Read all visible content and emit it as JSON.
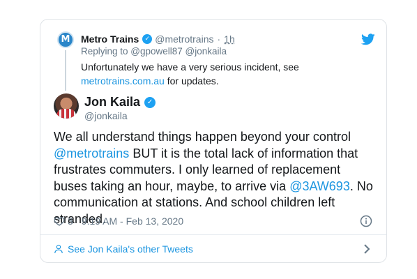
{
  "parent_tweet": {
    "avatar_text": "M",
    "name": "Metro Trains",
    "handle": "@metrotrains",
    "separator": "·",
    "time": "1h",
    "replying_prefix": "Replying to ",
    "replying_to": "@gpowell87 @jonkaila",
    "text_before_link": "Unfortunately we have a very serious incident, see ",
    "link": "metrotrains.com.au",
    "text_after_link": " for updates."
  },
  "main_tweet": {
    "name": "Jon Kaila",
    "handle": "@jonkaila",
    "text_part1": "We all understand things happen beyond your control ",
    "mention1": "@metrotrains",
    "text_part2": " BUT it is the total lack of information that frustrates commuters. I only learned of replacement buses taking an hour, maybe, to arrive via ",
    "mention2": "@3AW693",
    "text_part3": ". No communication at stations. And school children left stranded.",
    "likes": "3",
    "timestamp": "9:19 AM - Feb 13, 2020"
  },
  "footer": {
    "see_more_label": "See Jon Kaila's other Tweets"
  },
  "icons": {
    "verified": "verified-badge-icon",
    "twitter": "twitter-bird-icon",
    "heart": "heart-icon",
    "info": "info-icon",
    "user": "user-icon",
    "chevron": "chevron-right-icon"
  },
  "colors": {
    "accent": "#1da1f2",
    "link": "#1b95e0",
    "muted": "#657786",
    "text": "#14171a",
    "border": "#dfe3e7"
  }
}
